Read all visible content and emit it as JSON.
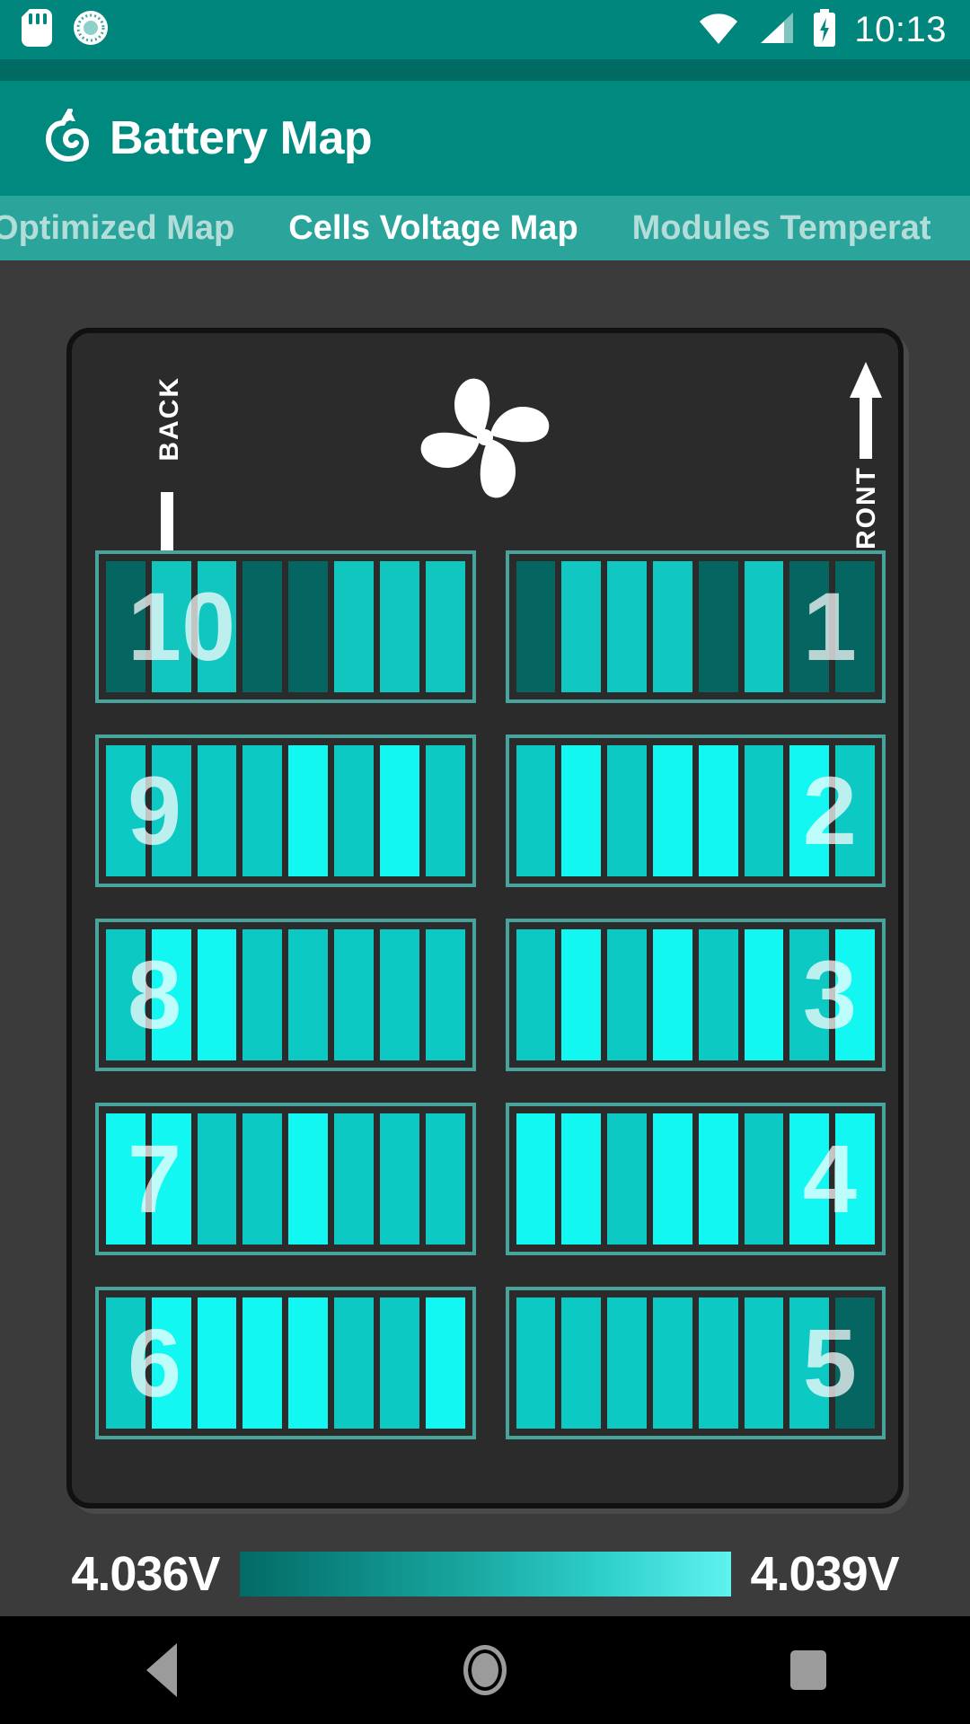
{
  "statusbar": {
    "icons": [
      "sd-card-icon",
      "sync-icon",
      "wifi-icon",
      "cellular-signal-icon",
      "battery-charging-icon"
    ],
    "clock": "10:13"
  },
  "appbar": {
    "icon": "leaf-spy-fox-icon",
    "title": "Battery Map"
  },
  "tabs": [
    {
      "label": "age Optimized Map",
      "active": false
    },
    {
      "label": "Cells Voltage Map",
      "active": true
    },
    {
      "label": "Modules Temperat",
      "active": false
    }
  ],
  "pack": {
    "back_label": "BACK",
    "front_label": "FRONT",
    "fan_icon": "fan-icon",
    "back_arrow_icon": "arrow-down-icon",
    "front_arrow_icon": "arrow-up-icon"
  },
  "legend": {
    "min": "4.036V",
    "max": "4.039V",
    "gradient_from": "#036a66",
    "gradient_to": "#5ff2ef"
  },
  "navbar": {
    "back": "back-button",
    "home": "home-button",
    "recents": "recents-button"
  },
  "chart_data": {
    "type": "heatmap",
    "title": "Cells Voltage Map",
    "unit": "V",
    "vmin": 4.036,
    "vmax": 4.039,
    "colormap": [
      "#036a66",
      "#0b7d78",
      "#0fa39c",
      "#11c9c2",
      "#1ce9e3",
      "#20ffff"
    ],
    "cells_per_module": 8,
    "layout": "2 columns x 5 rows; left column modules 10,9,8,7,6 top-to-bottom; right column modules 1,2,3,4,5 top-to-bottom",
    "modules": [
      {
        "id": "10",
        "side": "left",
        "row": 0,
        "label_side": "left",
        "values": [
          4.036,
          4.0385,
          4.0385,
          4.036,
          4.036,
          4.0385,
          4.0385,
          4.0385
        ],
        "colors": [
          "#056561",
          "#12c6c0",
          "#12c6c0",
          "#056561",
          "#056561",
          "#12c6c0",
          "#12c6c0",
          "#12c6c0"
        ]
      },
      {
        "id": "1",
        "side": "right",
        "row": 0,
        "label_side": "right",
        "values": [
          4.036,
          4.0385,
          4.0385,
          4.0385,
          4.036,
          4.0385,
          4.036,
          4.036
        ],
        "colors": [
          "#056561",
          "#10c7c1",
          "#10c7c1",
          "#10c7c1",
          "#056561",
          "#10c7c1",
          "#056561",
          "#056561"
        ]
      },
      {
        "id": "9",
        "side": "left",
        "row": 1,
        "label_side": "left",
        "values": [
          4.0385,
          4.0385,
          4.0385,
          4.0385,
          4.039,
          4.0385,
          4.039,
          4.0385
        ],
        "colors": [
          "#0cc9c3",
          "#0cc9c3",
          "#0cc9c3",
          "#0cc9c3",
          "#13f7f3",
          "#0cc9c3",
          "#13f7f3",
          "#0cc9c3"
        ]
      },
      {
        "id": "2",
        "side": "right",
        "row": 1,
        "label_side": "right",
        "values": [
          4.0385,
          4.039,
          4.0385,
          4.039,
          4.039,
          4.0385,
          4.039,
          4.0385
        ],
        "colors": [
          "#0cc9c3",
          "#13f7f3",
          "#0cc9c3",
          "#13f7f3",
          "#13f7f3",
          "#0cc9c3",
          "#13f7f3",
          "#0cc9c3"
        ]
      },
      {
        "id": "8",
        "side": "left",
        "row": 2,
        "label_side": "left",
        "values": [
          4.0385,
          4.039,
          4.039,
          4.0385,
          4.0385,
          4.0385,
          4.0385,
          4.0385
        ],
        "colors": [
          "#0cc9c3",
          "#13f7f3",
          "#13f7f3",
          "#0cc9c3",
          "#0cc9c3",
          "#0cc9c3",
          "#0cc9c3",
          "#0cc9c3"
        ]
      },
      {
        "id": "3",
        "side": "right",
        "row": 2,
        "label_side": "right",
        "values": [
          4.0385,
          4.039,
          4.0385,
          4.039,
          4.0385,
          4.039,
          4.0385,
          4.039
        ],
        "colors": [
          "#0cc9c3",
          "#13f7f3",
          "#0cc9c3",
          "#13f7f3",
          "#0cc9c3",
          "#13f7f3",
          "#0cc9c3",
          "#13f7f3"
        ]
      },
      {
        "id": "7",
        "side": "left",
        "row": 3,
        "label_side": "left",
        "values": [
          4.039,
          4.039,
          4.0385,
          4.0385,
          4.039,
          4.0385,
          4.0385,
          4.0385
        ],
        "colors": [
          "#13f7f3",
          "#13f7f3",
          "#0cc9c3",
          "#0cc9c3",
          "#13f7f3",
          "#0cc9c3",
          "#0cc9c3",
          "#0cc9c3"
        ]
      },
      {
        "id": "4",
        "side": "right",
        "row": 3,
        "label_side": "right",
        "values": [
          4.039,
          4.039,
          4.0385,
          4.039,
          4.039,
          4.0385,
          4.039,
          4.039
        ],
        "colors": [
          "#13f7f3",
          "#13f7f3",
          "#0cc9c3",
          "#13f7f3",
          "#13f7f3",
          "#0cc9c3",
          "#13f7f3",
          "#13f7f3"
        ]
      },
      {
        "id": "6",
        "side": "left",
        "row": 4,
        "label_side": "left",
        "values": [
          4.0385,
          4.039,
          4.039,
          4.039,
          4.039,
          4.0385,
          4.0385,
          4.039
        ],
        "colors": [
          "#0cc9c3",
          "#13f7f3",
          "#13f7f3",
          "#13f7f3",
          "#13f7f3",
          "#0cc9c3",
          "#0cc9c3",
          "#13f7f3"
        ]
      },
      {
        "id": "5",
        "side": "right",
        "row": 4,
        "label_side": "right",
        "values": [
          4.0385,
          4.0385,
          4.0385,
          4.0385,
          4.0385,
          4.0385,
          4.0385,
          4.036
        ],
        "colors": [
          "#0cc9c3",
          "#0cc9c3",
          "#0cc9c3",
          "#0cc9c3",
          "#0cc9c3",
          "#0cc9c3",
          "#0cc9c3",
          "#056561"
        ]
      }
    ]
  }
}
